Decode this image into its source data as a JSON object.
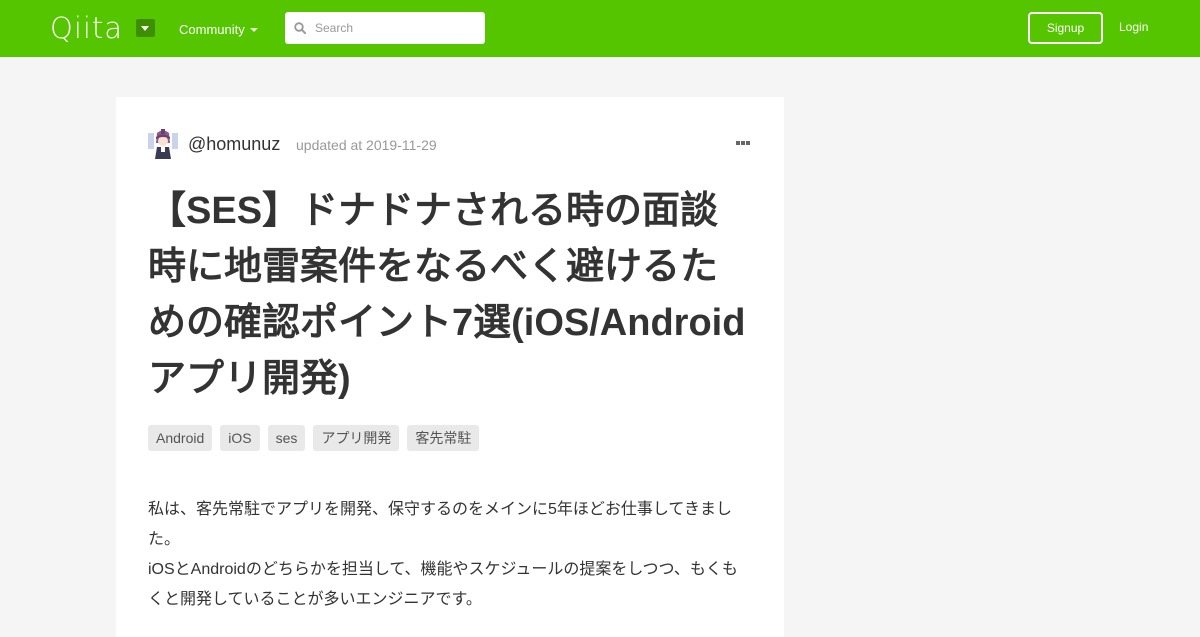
{
  "header": {
    "logo": "Qiita",
    "community_label": "Community",
    "search_placeholder": "Search",
    "signup_label": "Signup",
    "login_label": "Login"
  },
  "article": {
    "author": "@homunuz",
    "updated": "updated at 2019-11-29",
    "title": "【SES】ドナドナされる時の面談時に地雷案件をなるべく避けるための確認ポイント7選(iOS/Androidアプリ開発)",
    "tags": [
      "Android",
      "iOS",
      "ses",
      "アプリ開発",
      "客先常駐"
    ],
    "paragraphs": [
      "私は、客先常駐でアプリを開発、保守するのをメインに5年ほどお仕事してきました。",
      "iOSとAndroidのどちらかを担当して、機能やスケジュールの提案をしつつ、もくもくと開発していることが多いエンジニアです。"
    ]
  },
  "colors": {
    "brand": "#55c500",
    "brand_dark": "#3e8f00",
    "page_bg": "#f5f5f5",
    "card_bg": "#ffffff",
    "tag_bg": "#e9e9e9"
  },
  "icons": [
    "logo-menu-icon",
    "caret-down-icon",
    "search-icon",
    "avatar",
    "more-options-icon"
  ]
}
